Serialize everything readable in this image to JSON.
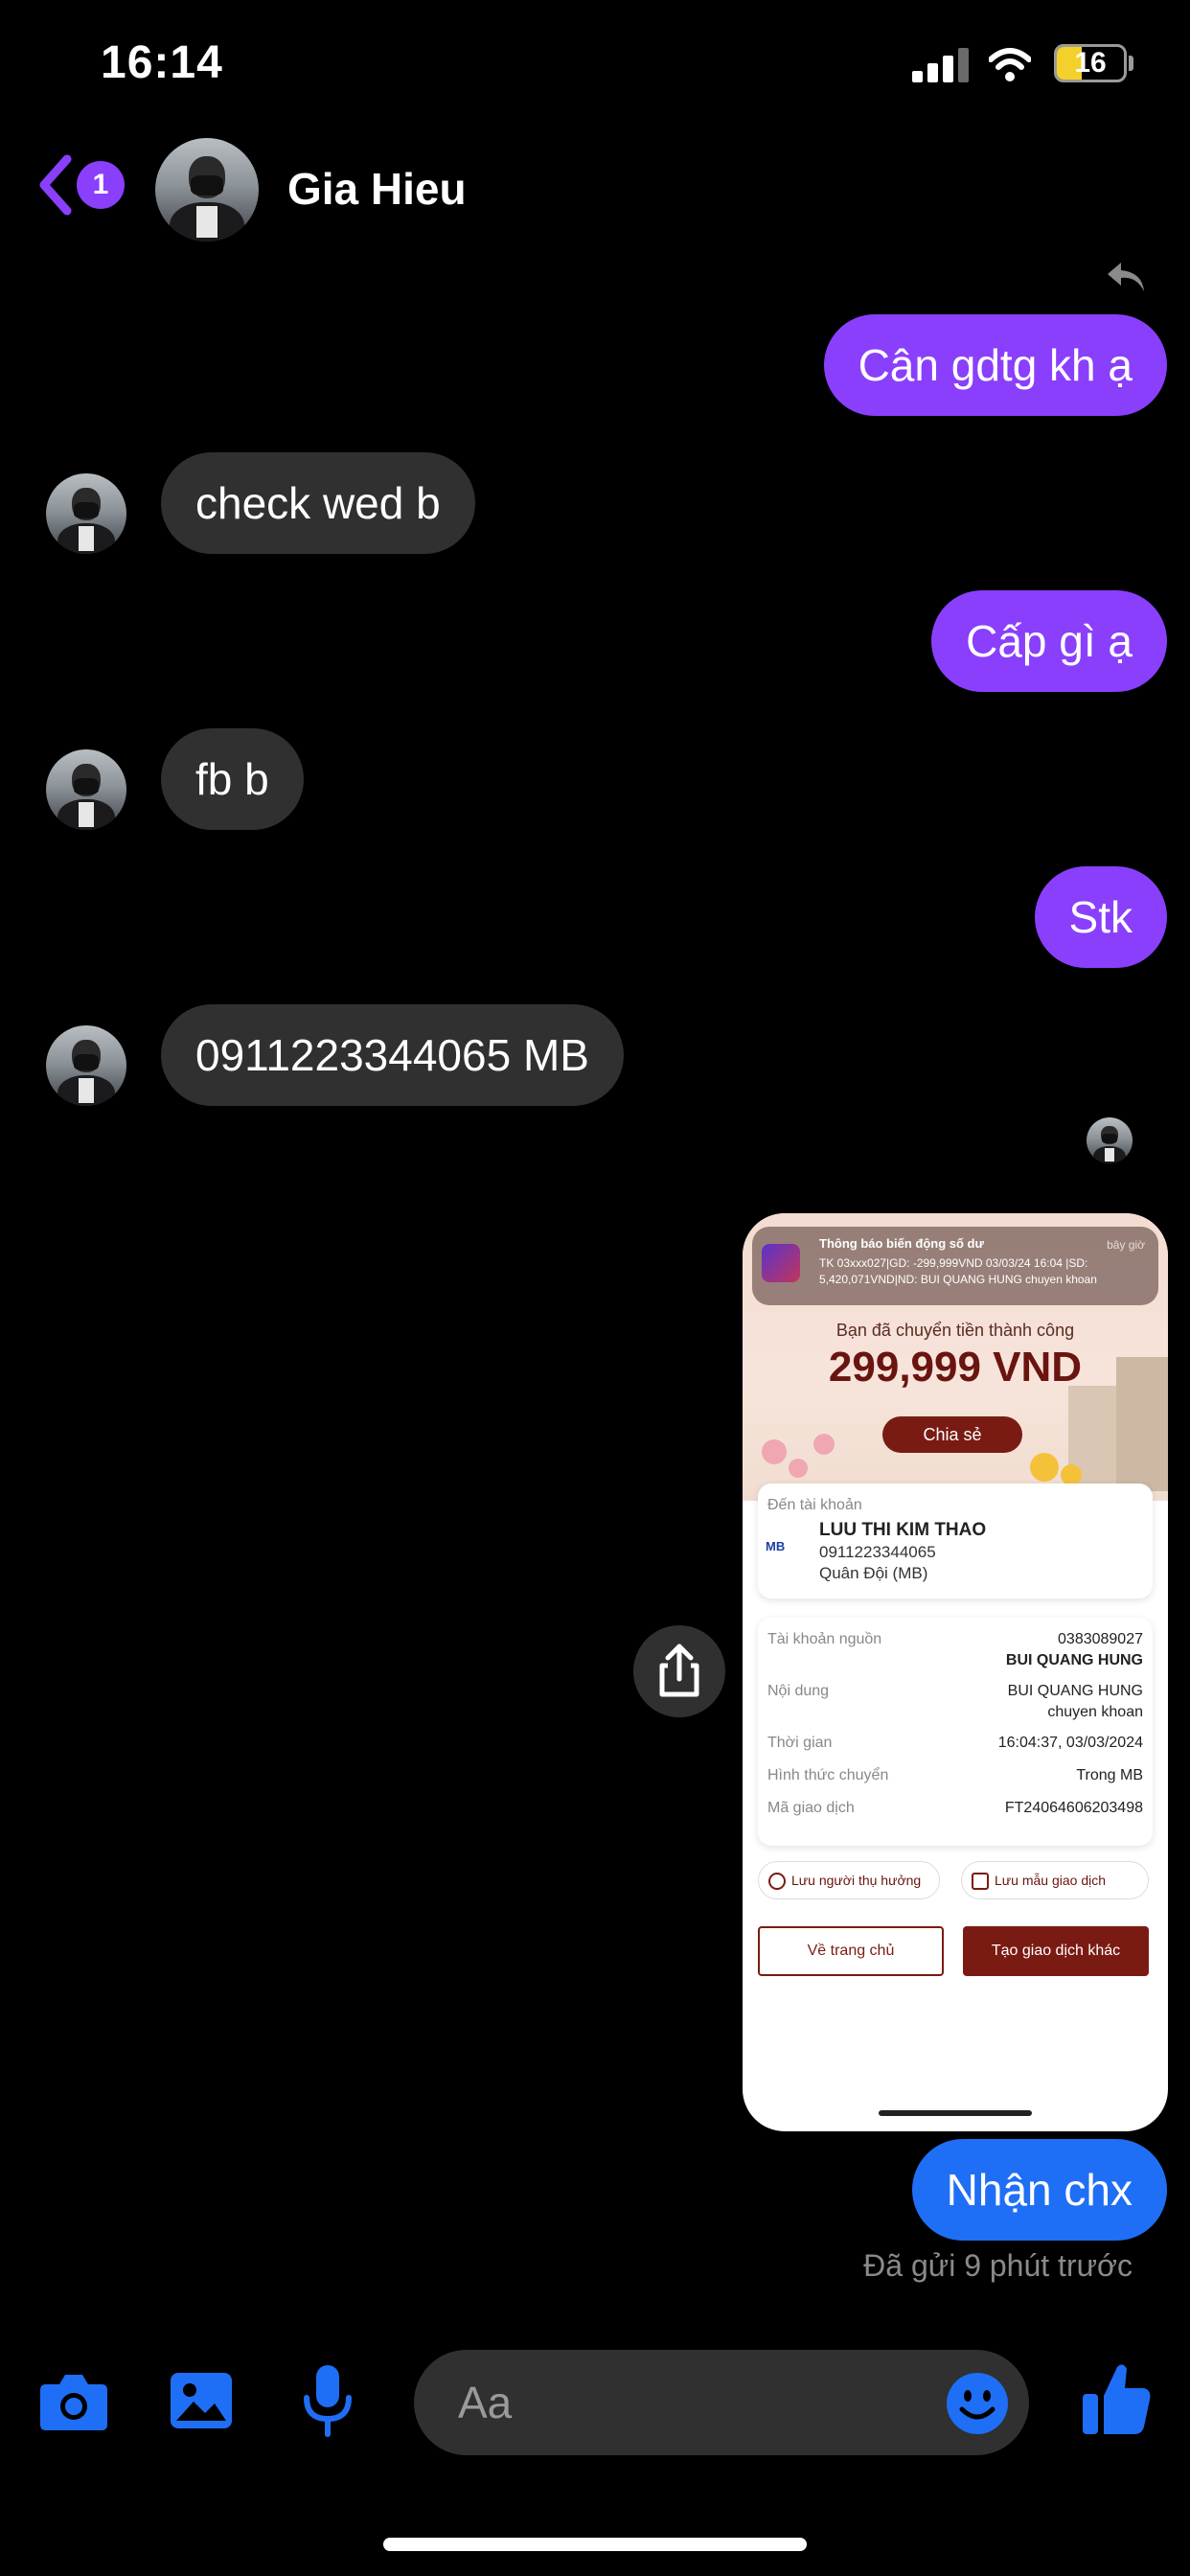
{
  "status_bar": {
    "time": "16:14",
    "battery": "16"
  },
  "header": {
    "unread_count": "1",
    "contact_name": "Gia Hieu"
  },
  "messages": [
    {
      "side": "out",
      "text": "Cân gdtg kh ạ"
    },
    {
      "side": "in",
      "text": "check wed b"
    },
    {
      "side": "out",
      "text": "Cấp gì ạ"
    },
    {
      "side": "in",
      "text": "fb b"
    },
    {
      "side": "out",
      "text": "Stk"
    },
    {
      "side": "in",
      "text": "0911223344065 MB"
    },
    {
      "side": "out",
      "text": "Nhận chx"
    }
  ],
  "attachment": {
    "notification": {
      "title": "Thông báo biến động số dư",
      "when": "bây giờ",
      "body": "TK 03xxx027|GD: -299,999VND 03/03/24 16:04 |SD: 5,420,071VND|ND: BUI QUANG HUNG chuyen khoan"
    },
    "success_text": "Bạn đã chuyển tiền thành công",
    "amount": "299,999 VND",
    "share_label": "Chia sẻ",
    "recipient": {
      "label": "Đến tài khoản",
      "bank_logo": "MB",
      "name": "LUU THI KIM THAO",
      "account": "0911223344065",
      "bank": "Quân Đội (MB)"
    },
    "details": {
      "source_label": "Tài khoản nguồn",
      "source_account": "0383089027",
      "source_name": "BUI QUANG HUNG",
      "content_label": "Nội dung",
      "content_line1": "BUI QUANG HUNG",
      "content_line2": "chuyen khoan",
      "time_label": "Thời gian",
      "time_value": "16:04:37, 03/03/2024",
      "method_label": "Hình thức chuyển",
      "method_value": "Trong MB",
      "txn_label": "Mã giao dịch",
      "txn_value": "FT24064606203498"
    },
    "save_beneficiary": "Lưu người thụ hưởng",
    "save_template": "Lưu mẫu giao dịch",
    "home_button": "Về trang chủ",
    "new_txn_button": "Tạo giao dịch khác"
  },
  "sent_status": "Đã gửi 9 phút trước",
  "composer": {
    "placeholder": "Aa"
  },
  "icons": {
    "camera": "camera-icon",
    "gallery": "gallery-icon",
    "mic": "microphone-icon",
    "emoji": "emoji-icon",
    "like": "thumbs-up-icon",
    "share": "share-icon",
    "reply": "reply-icon"
  },
  "colors": {
    "outgoing": "#8a3ffc",
    "incoming": "#303030",
    "accent_blue": "#1f6ef6",
    "bank_red": "#7a1b13"
  }
}
